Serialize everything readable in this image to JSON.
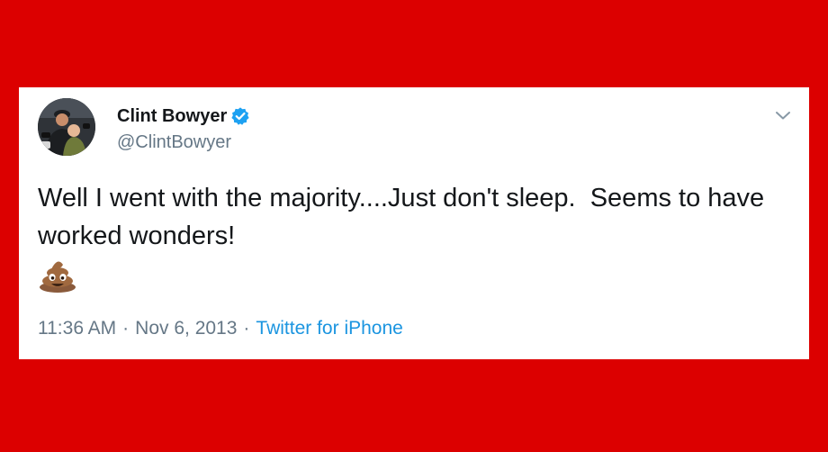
{
  "tweet": {
    "display_name": "Clint Bowyer",
    "handle": "@ClintBowyer",
    "text": "Well I went with the majority....Just don't sleep.  Seems to have worked wonders!",
    "emoji": "pile-of-poo",
    "time": "11:36 AM",
    "date": "Nov 6, 2013",
    "separator": "·",
    "source": "Twitter for iPhone",
    "verified": true
  },
  "colors": {
    "background": "#dc0000",
    "card": "#ffffff",
    "text": "#14171a",
    "secondary_text": "#657786",
    "link": "#1b95e0",
    "verified_badge": "#1da1f2"
  },
  "icons": {
    "verified": "verified-badge-icon",
    "menu": "chevron-down-icon",
    "emoji": "pile-of-poo-emoji"
  }
}
